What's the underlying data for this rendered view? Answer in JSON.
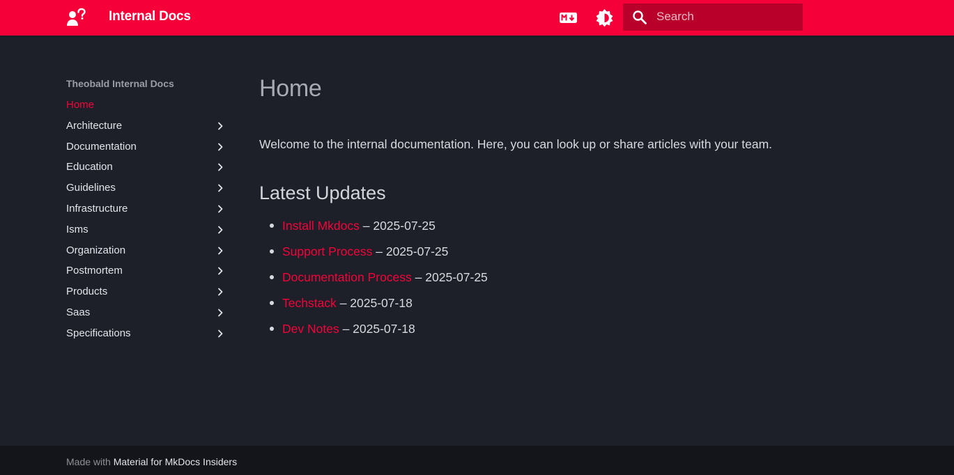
{
  "header": {
    "site_title": "Internal Docs",
    "logo_icon": "question-person-icon",
    "markdown_icon": "markdown-icon",
    "palette_icon": "brightness-icon",
    "search": {
      "placeholder": "Search",
      "value": "",
      "icon": "search-icon"
    },
    "accent_color": "#f50039"
  },
  "sidebar": {
    "title": "Theobald Internal Docs",
    "items": [
      {
        "label": "Home",
        "active": true
      },
      {
        "label": "Architecture"
      },
      {
        "label": "Documentation"
      },
      {
        "label": "Education"
      },
      {
        "label": "Guidelines"
      },
      {
        "label": "Infrastructure"
      },
      {
        "label": "Isms"
      },
      {
        "label": "Organization"
      },
      {
        "label": "Postmortem"
      },
      {
        "label": "Products"
      },
      {
        "label": "Saas"
      },
      {
        "label": "Specifications"
      }
    ]
  },
  "content": {
    "title": "Home",
    "welcome": "Welcome to the internal documentation. Here, you can look up or share articles with your team.",
    "latest_heading": "Latest Updates",
    "updates": [
      {
        "title": "Install Mkdocs",
        "date": "– 2025-07-25"
      },
      {
        "title": "Support Process",
        "date": "– 2025-07-25"
      },
      {
        "title": "Documentation Process",
        "date": "– 2025-07-25"
      },
      {
        "title": "Techstack",
        "date": "– 2025-07-18"
      },
      {
        "title": "Dev Notes",
        "date": "– 2025-07-18"
      }
    ]
  },
  "footer": {
    "prefix": "Made with",
    "link": "Material for MkDocs Insiders"
  }
}
